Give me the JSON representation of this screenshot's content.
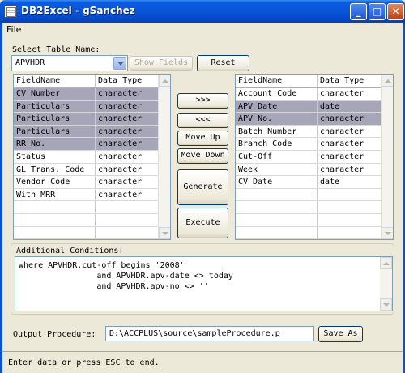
{
  "window": {
    "title": "DB2Excel - gSanchez",
    "controls": [
      "minimize",
      "maximize",
      "close"
    ]
  },
  "menu": {
    "file": "File"
  },
  "table_select": {
    "label": "Select Table Name:",
    "value": "APVHDR",
    "show_fields": "Show Fields",
    "reset": "Reset"
  },
  "left_list": {
    "headers": [
      "FieldName",
      "Data Type"
    ],
    "rows": [
      {
        "name": "CV Number",
        "type": "character",
        "selected": true
      },
      {
        "name": "Particulars",
        "type": "character",
        "selected": true
      },
      {
        "name": "Particulars",
        "type": "character",
        "selected": true
      },
      {
        "name": "Particulars",
        "type": "character",
        "selected": true
      },
      {
        "name": "RR No.",
        "type": "character",
        "selected": true
      },
      {
        "name": "Status",
        "type": "character",
        "selected": false
      },
      {
        "name": "GL Trans. Code",
        "type": "character",
        "selected": false
      },
      {
        "name": "Vendor Code",
        "type": "character",
        "selected": false
      },
      {
        "name": "With MRR",
        "type": "character",
        "selected": false
      }
    ]
  },
  "right_list": {
    "headers": [
      "FieldName",
      "Data Type"
    ],
    "rows": [
      {
        "name": "Account Code",
        "type": "character",
        "selected": false
      },
      {
        "name": "APV Date",
        "type": "date",
        "selected": true
      },
      {
        "name": "APV No.",
        "type": "character",
        "selected": true
      },
      {
        "name": "Batch Number",
        "type": "character",
        "selected": false
      },
      {
        "name": "Branch Code",
        "type": "character",
        "selected": false
      },
      {
        "name": "Cut-Off",
        "type": "character",
        "selected": false
      },
      {
        "name": "Week",
        "type": "character",
        "selected": false
      },
      {
        "name": "CV Date",
        "type": "date",
        "selected": false
      }
    ]
  },
  "buttons": {
    "move_right": ">>>",
    "move_left": "<<<",
    "move_up": "Move Up",
    "move_down": "Move Down",
    "generate": "Generate",
    "execute": "Execute"
  },
  "conditions": {
    "label": "Additional Conditions:",
    "text": "where APVHDR.cut-off begins '2008'\n                and APVHDR.apv-date <> today\n                and APVHDR.apv-no <> ''"
  },
  "output": {
    "label": "Output Procedure:",
    "value": "D:\\ACCPLUS\\source\\sampleProcedure.p",
    "save_as": "Save As"
  },
  "status": {
    "text": "Enter data or press ESC to end."
  }
}
